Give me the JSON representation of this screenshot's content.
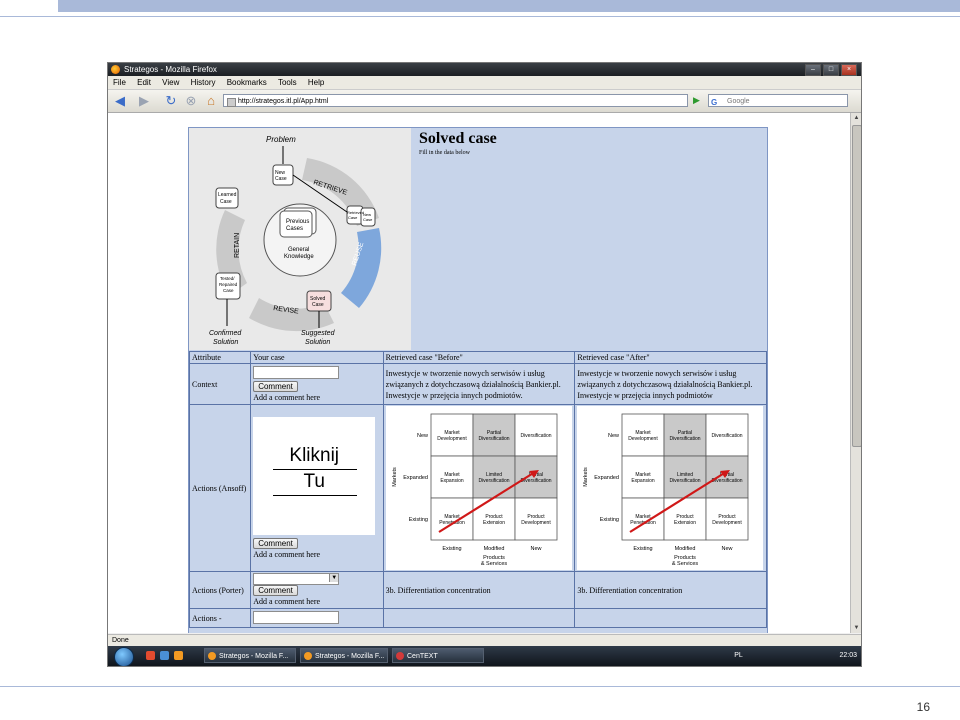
{
  "slide": {
    "number": "16"
  },
  "browser": {
    "window_title": "Strategos - Mozilla Firefox",
    "menu": [
      "File",
      "Edit",
      "View",
      "History",
      "Bookmarks",
      "Tools",
      "Help"
    ],
    "url": "http://strategos.itl.pl/App.html",
    "search_placeholder": "Google",
    "status": "Done"
  },
  "taskbar": {
    "items": [
      "Strategos - Mozilla F...",
      "Strategos - Mozilla F...",
      "CenTEXT"
    ],
    "lang": "PL",
    "clock": "22:03"
  },
  "cbr_diagram": {
    "problem": "Problem",
    "new_case": [
      "New",
      "Case"
    ],
    "retrieve": "RETRIEVE",
    "learned_case": [
      "Learned",
      "Case"
    ],
    "previous_cases": [
      "Previous",
      "Cases"
    ],
    "general_knowledge": [
      "General",
      "Knowledge"
    ],
    "retrieved_case": [
      "Retrieved",
      "Case"
    ],
    "new_small": [
      "New",
      "Case"
    ],
    "retain": "RETAIN",
    "reuse": "REUSE",
    "tested_case": [
      "Tested/",
      "Repaired",
      "Case"
    ],
    "revise": "REVISE",
    "solved_case": [
      "Solved",
      "Case"
    ],
    "confirmed_solution": [
      "Confirmed",
      "Solution"
    ],
    "suggested_solution": [
      "Suggested",
      "Solution"
    ]
  },
  "solved_case": {
    "title": "Solved case",
    "subtitle": "Fill in the data below"
  },
  "table": {
    "headers": [
      "Attribute",
      "Your case",
      "Retrieved case \"Before\"",
      "Retrieved case \"After\""
    ],
    "comment_label": "Comment",
    "add_comment": "Add a comment here",
    "rows": {
      "context": {
        "label": "Context",
        "before": "Inwestycje w tworzenie nowych serwisów i usług związanych z dotychczasową działalnością Bankier.pl. Inwestycje w przejęcia innych podmiotów.",
        "after": "Inwestycje w tworzenie nowych serwisów i usług związanych z dotychczasową działalnością Bankier.pl. Inwestycje w przejęcia innych podmiotów"
      },
      "ansoff": {
        "label": "Actions (Ansoff)",
        "click_line1": "Kliknij",
        "click_line2": "Tu"
      },
      "porter": {
        "label": "Actions (Porter)",
        "before": "3b. Differentiation concentration",
        "after": "3b. Differentiation concentration"
      },
      "more": {
        "label": "Actions -"
      }
    }
  },
  "ansoff_matrix": {
    "markets_label": "Markets",
    "rows": [
      "New",
      "Expanded",
      "Existing"
    ],
    "cols": [
      "Existing",
      "Modified",
      "New"
    ],
    "products_label": [
      "Products",
      "& Services"
    ],
    "cells": [
      [
        [
          "Market",
          "Development"
        ],
        [
          "Partial",
          "Diversification"
        ],
        [
          "Diversification"
        ]
      ],
      [
        [
          "Market",
          "Expansion"
        ],
        [
          "Limited",
          "Diversification"
        ],
        [
          "Partial",
          "Diversification"
        ]
      ],
      [
        [
          "Market",
          "Penetration"
        ],
        [
          "Product",
          "Extension"
        ],
        [
          "Product",
          "Development"
        ]
      ]
    ]
  }
}
